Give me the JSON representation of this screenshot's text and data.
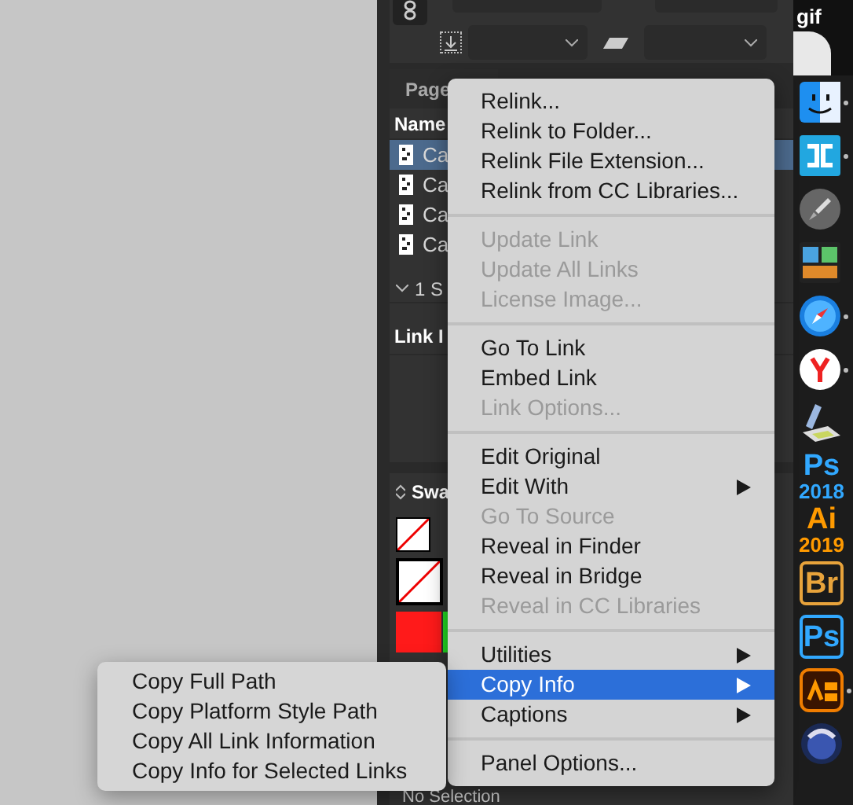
{
  "panel": {
    "tabs": [
      {
        "label": "Page",
        "selected": false
      }
    ],
    "header": "Name",
    "links": [
      {
        "name": "Ca",
        "selected": true
      },
      {
        "name": "Ca",
        "selected": false
      },
      {
        "name": "Ca",
        "selected": false
      },
      {
        "name": "Ca",
        "selected": false
      }
    ],
    "summary": "1 S",
    "info_header": "Link I",
    "swatches_header": "Swa",
    "status": "No Selection"
  },
  "thumbnail": {
    "label": "gif"
  },
  "context_menu": {
    "sections": [
      [
        {
          "label": "Relink...",
          "disabled": false,
          "submenu": false,
          "selected": false
        },
        {
          "label": "Relink to Folder...",
          "disabled": false,
          "submenu": false,
          "selected": false
        },
        {
          "label": "Relink File Extension...",
          "disabled": false,
          "submenu": false,
          "selected": false
        },
        {
          "label": "Relink from CC Libraries...",
          "disabled": false,
          "submenu": false,
          "selected": false
        }
      ],
      [
        {
          "label": "Update Link",
          "disabled": true,
          "submenu": false,
          "selected": false
        },
        {
          "label": "Update All Links",
          "disabled": true,
          "submenu": false,
          "selected": false
        },
        {
          "label": "License Image...",
          "disabled": true,
          "submenu": false,
          "selected": false
        }
      ],
      [
        {
          "label": "Go To Link",
          "disabled": false,
          "submenu": false,
          "selected": false
        },
        {
          "label": "Embed Link",
          "disabled": false,
          "submenu": false,
          "selected": false
        },
        {
          "label": "Link Options...",
          "disabled": true,
          "submenu": false,
          "selected": false
        }
      ],
      [
        {
          "label": "Edit Original",
          "disabled": false,
          "submenu": false,
          "selected": false
        },
        {
          "label": "Edit With",
          "disabled": false,
          "submenu": true,
          "selected": false
        },
        {
          "label": "Go To Source",
          "disabled": true,
          "submenu": false,
          "selected": false
        },
        {
          "label": "Reveal in Finder",
          "disabled": false,
          "submenu": false,
          "selected": false
        },
        {
          "label": "Reveal in Bridge",
          "disabled": false,
          "submenu": false,
          "selected": false
        },
        {
          "label": "Reveal in CC Libraries",
          "disabled": true,
          "submenu": false,
          "selected": false
        }
      ],
      [
        {
          "label": "Utilities",
          "disabled": false,
          "submenu": true,
          "selected": false
        },
        {
          "label": "Copy Info",
          "disabled": false,
          "submenu": true,
          "selected": true
        },
        {
          "label": "Captions",
          "disabled": false,
          "submenu": true,
          "selected": false
        }
      ],
      [
        {
          "label": "Panel Options...",
          "disabled": false,
          "submenu": false,
          "selected": false
        }
      ]
    ]
  },
  "submenu": {
    "items": [
      {
        "label": "Copy Full Path"
      },
      {
        "label": "Copy Platform Style Path"
      },
      {
        "label": "Copy All Link Information"
      },
      {
        "label": "Copy Info for Selected Links"
      }
    ]
  },
  "dock": [
    {
      "kind": "finder",
      "running": true
    },
    {
      "kind": "brackets",
      "running": true
    },
    {
      "kind": "rocket",
      "running": false
    },
    {
      "kind": "book",
      "running": false
    },
    {
      "kind": "compass",
      "running": true
    },
    {
      "kind": "ybrowser",
      "running": true
    },
    {
      "kind": "scanner",
      "running": false
    },
    {
      "kind": "tile",
      "label": "Ps",
      "caption": "2018",
      "color": "#31a8ff",
      "outlined": false,
      "running": false
    },
    {
      "kind": "tile",
      "label": "Ai",
      "caption": "2019",
      "color": "#ff9a00",
      "outlined": false,
      "running": false
    },
    {
      "kind": "tile",
      "label": "Br",
      "color": "#e8a33b",
      "outlined": true,
      "running": false
    },
    {
      "kind": "tile",
      "label": "Ps",
      "color": "#31a8ff",
      "outlined": true,
      "running": false
    },
    {
      "kind": "animate",
      "running": true
    },
    {
      "kind": "sphere",
      "running": false
    }
  ]
}
